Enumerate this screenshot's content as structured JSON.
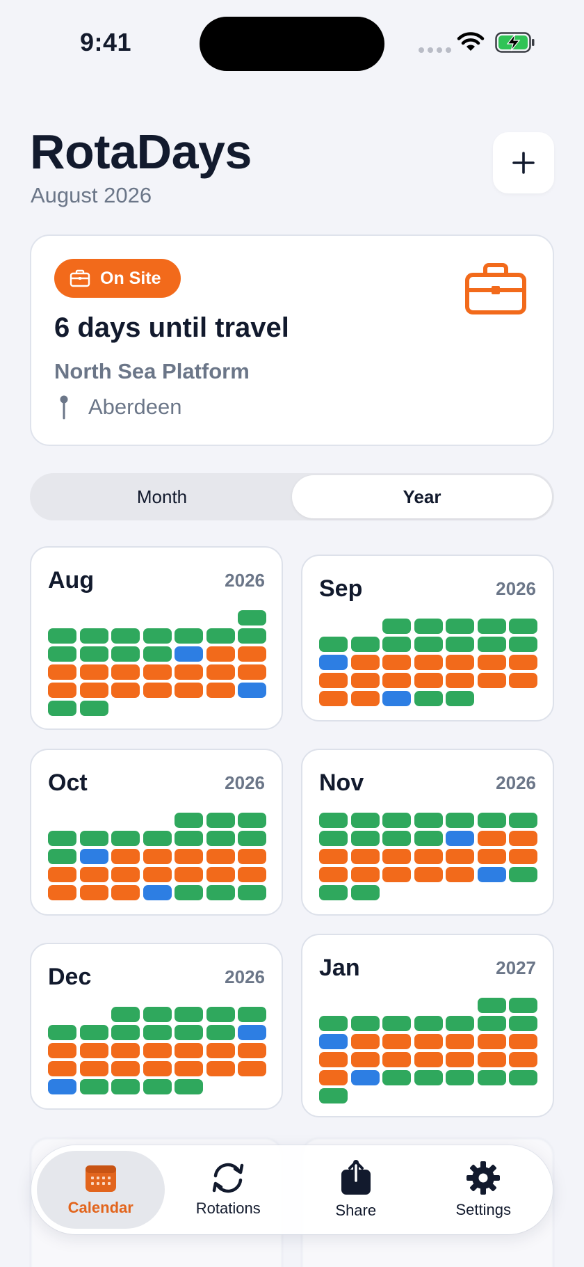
{
  "status_bar": {
    "time": "9:41"
  },
  "header": {
    "title": "RotaDays",
    "subtitle": "August 2026",
    "add_label": "+"
  },
  "status_card": {
    "badge": "On Site",
    "headline": "6 days until travel",
    "location_name": "North Sea Platform",
    "city": "Aberdeen",
    "accent_color": "#f26a1b"
  },
  "view_toggle": {
    "options": [
      "Month",
      "Year"
    ],
    "selected": "Year"
  },
  "legend_colors": {
    "home": "#2fa85d",
    "work": "#f26a1b",
    "travel": "#2d7ee3"
  },
  "months": [
    {
      "name": "Aug",
      "year": "2026",
      "offset": 6,
      "days": "HHHHHHHHHHHHTWWWWWWWWWWWWWWWTHH"
    },
    {
      "name": "Sep",
      "year": "2026",
      "offset": 2,
      "days": "HHHHHHHHHHHHTWWWWWWWWWWWWWWWTHH"
    },
    {
      "name": "Oct",
      "year": "2026",
      "offset": 4,
      "days": "HHHHHHHHHHHTWWWWWWWWWWWWWWWTHHH"
    },
    {
      "name": "Nov",
      "year": "2026",
      "offset": 0,
      "days": "HHHHHHHHHHHTWWWWWWWWWWWWWWTHHH"
    },
    {
      "name": "Dec",
      "year": "2026",
      "offset": 2,
      "days": "HHHHHHHHHHHTWWWWWWWWWWWWWWTHHHH"
    },
    {
      "name": "Jan",
      "year": "2027",
      "offset": 5,
      "days": "HHHHHHHHHTWWWWWWWWWWWWWWTHHHHHH"
    }
  ],
  "tabs": [
    {
      "label": "Calendar",
      "icon": "calendar-icon",
      "active": true
    },
    {
      "label": "Rotations",
      "icon": "rotate-icon",
      "active": false
    },
    {
      "label": "Share",
      "icon": "share-icon",
      "active": false
    },
    {
      "label": "Settings",
      "icon": "gear-icon",
      "active": false
    }
  ]
}
